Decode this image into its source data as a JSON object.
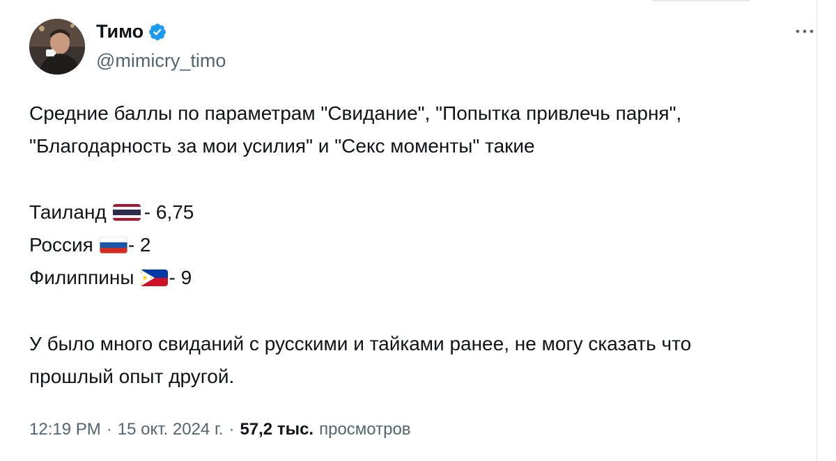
{
  "author": {
    "name": "Тимо",
    "handle": "@mimicry_timo"
  },
  "tweet": {
    "paragraph1": [
      "Средние баллы по параметрам \"Свидание\", \"Попытка привлечь парня\",",
      "\"Благодарность за мои усилия\" и \"Секс моменты\" такие"
    ],
    "scores": [
      {
        "country": "Таиланд",
        "flag": "thailand-flag-icon",
        "value": "- 6,75"
      },
      {
        "country": "Россия",
        "flag": "russia-flag-icon",
        "value": "- 2"
      },
      {
        "country": "Филиппины",
        "flag": "philippines-flag-icon",
        "value": "- 9"
      }
    ],
    "paragraph2": [
      "У было много свиданий с русскими и тайками ранее, не могу сказать что",
      "прошлый опыт другой."
    ]
  },
  "meta": {
    "time": "12:19 PM",
    "date": "15 окт. 2024 г.",
    "views_count": "57,2 тыс.",
    "views_label": "просмотров"
  },
  "colors": {
    "primary_text": "#0f1419",
    "secondary_text": "#536471",
    "verified_blue": "#1d9bf0"
  }
}
